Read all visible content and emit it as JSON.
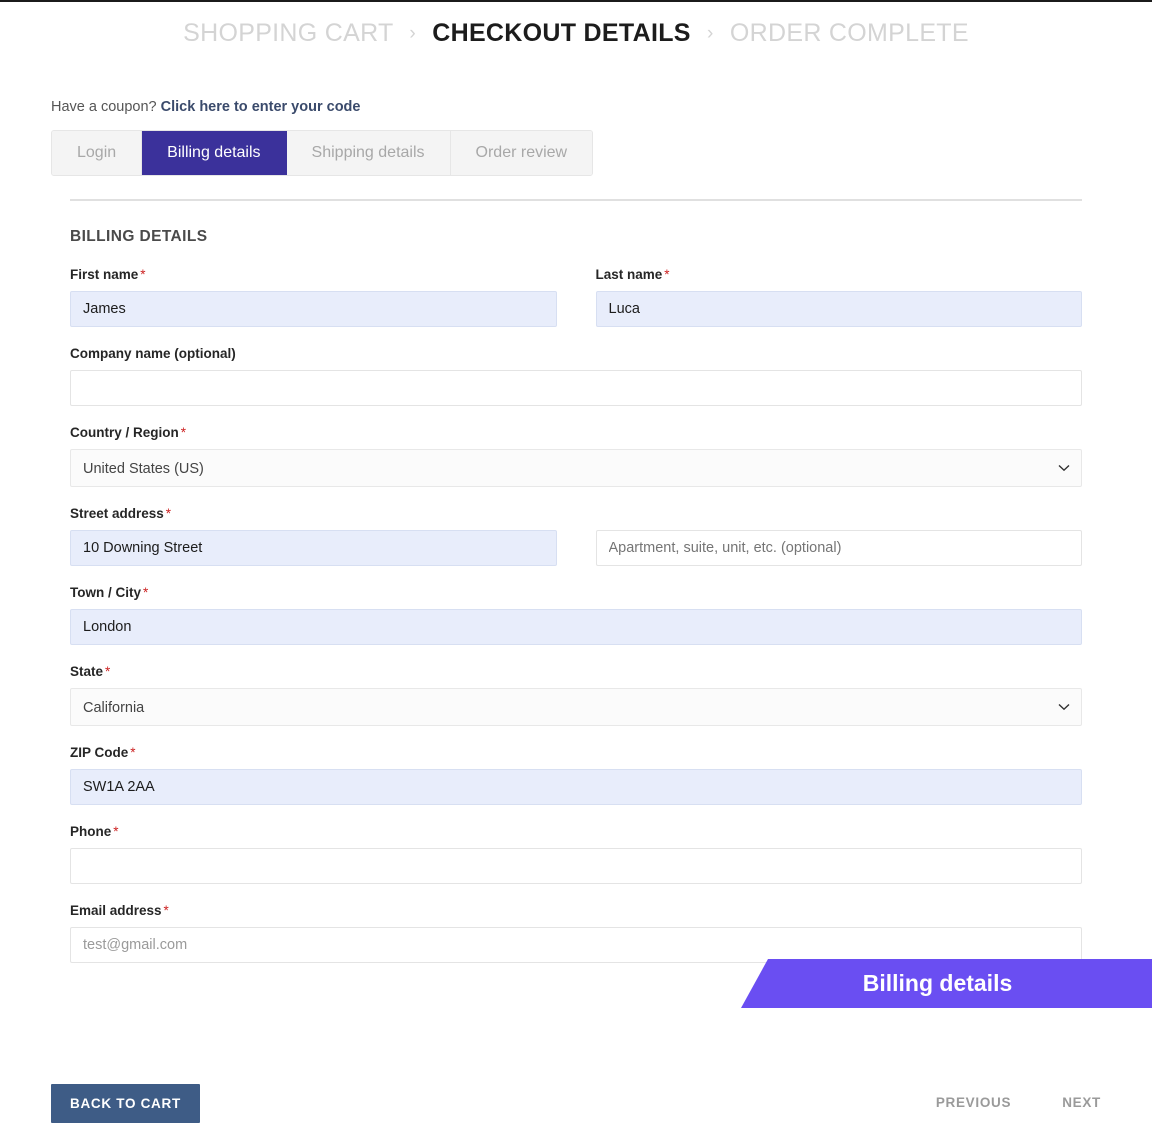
{
  "breadcrumb": {
    "steps": [
      {
        "label": "SHOPPING CART",
        "state": "past"
      },
      {
        "label": "CHECKOUT DETAILS",
        "state": "current"
      },
      {
        "label": "ORDER COMPLETE",
        "state": "future"
      }
    ],
    "separator": "›"
  },
  "coupon": {
    "prompt": "Have a coupon?",
    "link": "Click here to enter your code"
  },
  "tabs": [
    {
      "label": "Login",
      "active": false
    },
    {
      "label": "Billing details",
      "active": true
    },
    {
      "label": "Shipping details",
      "active": false
    },
    {
      "label": "Order review",
      "active": false
    }
  ],
  "billing": {
    "section_title": "BILLING DETAILS",
    "required_mark": "*",
    "first_name": {
      "label": "First name",
      "value": "James",
      "filled": true
    },
    "last_name": {
      "label": "Last name",
      "value": "Luca",
      "filled": true
    },
    "company": {
      "label": "Company name (optional)",
      "value": "",
      "placeholder": ""
    },
    "country": {
      "label": "Country / Region",
      "value": "United States (US)"
    },
    "street": {
      "label": "Street address",
      "value": "10 Downing Street",
      "filled": true,
      "apartment_placeholder": "Apartment, suite, unit, etc. (optional)",
      "apartment_value": ""
    },
    "city": {
      "label": "Town / City",
      "value": "London",
      "filled": true
    },
    "state": {
      "label": "State",
      "value": "California"
    },
    "zip": {
      "label": "ZIP Code",
      "value": "SW1A 2AA",
      "filled": true
    },
    "phone": {
      "label": "Phone",
      "value": "",
      "placeholder": ""
    },
    "email": {
      "label": "Email address",
      "value": "test@gmail.com",
      "filled": false
    }
  },
  "banner": {
    "label": "Billing details",
    "color": "#6a4ef2"
  },
  "footer": {
    "back_to_cart": "BACK TO CART",
    "previous": "PREVIOUS",
    "next": "NEXT"
  },
  "colors": {
    "accent_tab": "#3b319b",
    "banner": "#6a4ef2",
    "back_button": "#3e5c86",
    "autofill": "#e8edfb",
    "required": "#cc2222"
  }
}
